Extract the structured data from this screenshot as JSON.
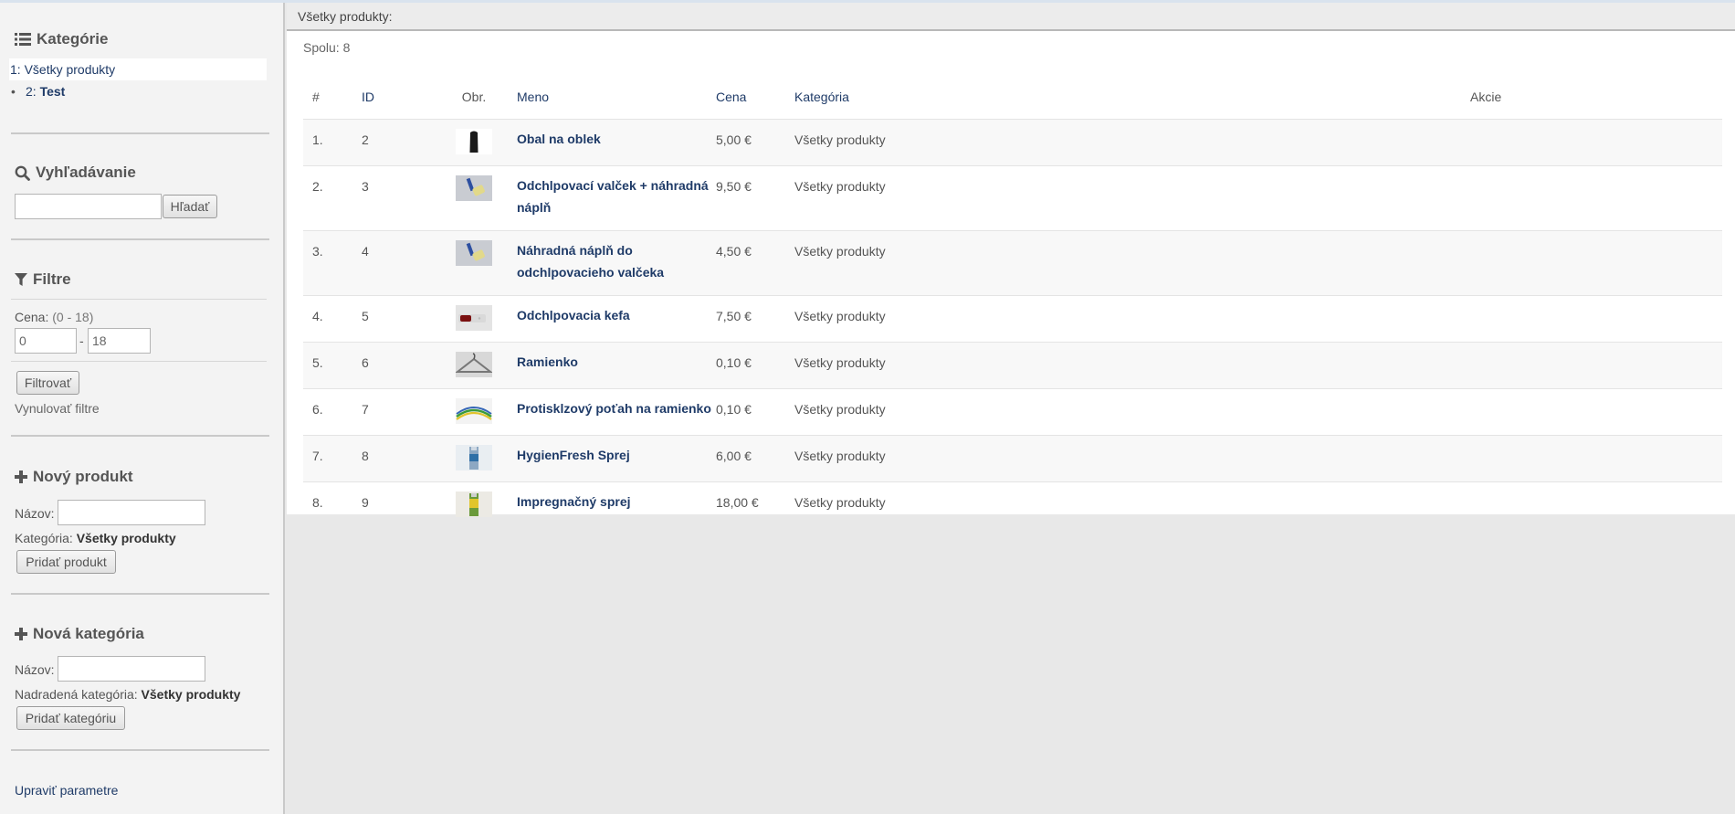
{
  "sidebar": {
    "categories": {
      "title": "Kategórie",
      "active_item": "1: Všetky produkty",
      "sub_item_prefix": "2:",
      "sub_item_label": "Test"
    },
    "search": {
      "title": "Vyhľadávanie",
      "input_value": "",
      "button_label": "Hľadať"
    },
    "filters": {
      "title": "Filtre",
      "price_label": "Cena:",
      "price_range": "(0 - 18)",
      "min_value": "0",
      "max_value": "18",
      "separator": "-",
      "filter_button": "Filtrovať",
      "reset_link": "Vynulovať filtre"
    },
    "new_product": {
      "title": "Nový produkt",
      "name_label": "Názov:",
      "category_label": "Kategória:",
      "category_value": "Všetky produkty",
      "button_label": "Pridať produkt"
    },
    "new_category": {
      "title": "Nová kategória",
      "name_label": "Názov:",
      "parent_label": "Nadradená kategória:",
      "parent_value": "Všetky produkty",
      "button_label": "Pridať kategóriu"
    },
    "edit_params_link": "Upraviť parametre"
  },
  "main": {
    "header": "Všetky produkty:",
    "total": "Spolu: 8",
    "columns": {
      "idx": "#",
      "id": "ID",
      "img": "Obr.",
      "name": "Meno",
      "price": "Cena",
      "category": "Kategória",
      "actions": "Akcie"
    },
    "rows": [
      {
        "idx": "1.",
        "id": "2",
        "name": "Obal na oblek",
        "price": "5,00 €",
        "category": "Všetky produkty",
        "thumb": "bag"
      },
      {
        "idx": "2.",
        "id": "3",
        "name": "Odchlpovací valček + náhradná náplň",
        "price": "9,50 €",
        "category": "Všetky produkty",
        "thumb": "roller"
      },
      {
        "idx": "3.",
        "id": "4",
        "name": "Náhradná náplň do odchlpovacieho valčeka",
        "price": "4,50 €",
        "category": "Všetky produkty",
        "thumb": "roller"
      },
      {
        "idx": "4.",
        "id": "5",
        "name": "Odchlpovacia kefa",
        "price": "7,50 €",
        "category": "Všetky produkty",
        "thumb": "brush"
      },
      {
        "idx": "5.",
        "id": "6",
        "name": "Ramienko",
        "price": "0,10 €",
        "category": "Všetky produkty",
        "thumb": "hanger"
      },
      {
        "idx": "6.",
        "id": "7",
        "name": "Protisklzový poťah na ramienko",
        "price": "0,10 €",
        "category": "Všetky produkty",
        "thumb": "cover"
      },
      {
        "idx": "7.",
        "id": "8",
        "name": "HygienFresh Sprej",
        "price": "6,00 €",
        "category": "Všetky produkty",
        "thumb": "spray"
      },
      {
        "idx": "8.",
        "id": "9",
        "name": "Impregnačný sprej",
        "price": "18,00 €",
        "category": "Všetky produkty",
        "thumb": "spray2"
      }
    ]
  }
}
